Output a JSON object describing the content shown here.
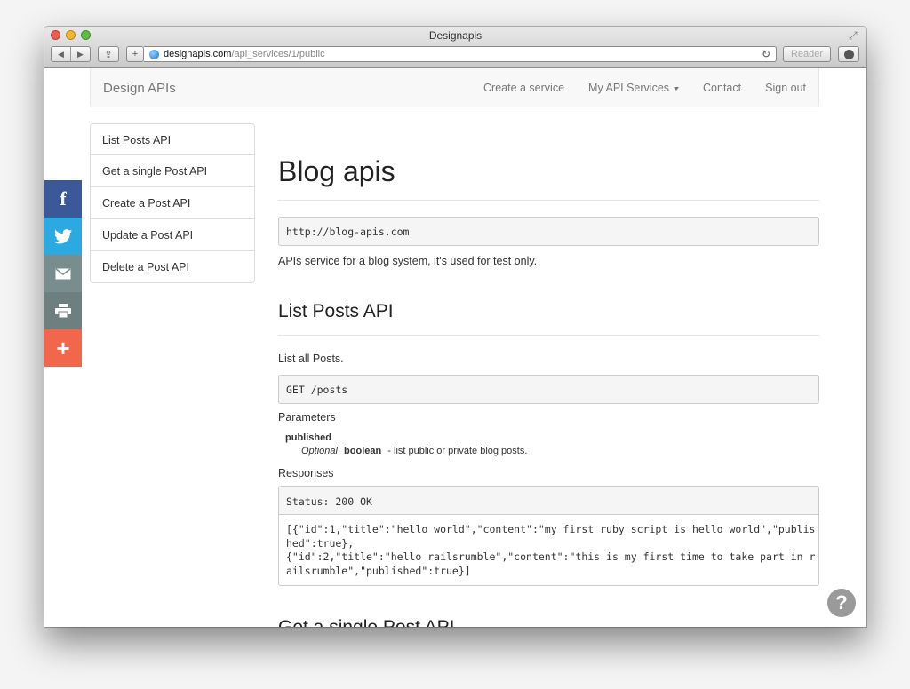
{
  "window": {
    "title": "Designapis",
    "url_domain": "designapis.com",
    "url_path": "/api_services/1/public",
    "reader_label": "Reader"
  },
  "navbar": {
    "brand": "Design APIs",
    "links": [
      "Create a service",
      "My API Services",
      "Contact",
      "Sign out"
    ]
  },
  "sidebar": {
    "items": [
      "List Posts API",
      "Get a single Post API",
      "Create a Post API",
      "Update a Post API",
      "Delete a Post API"
    ]
  },
  "share": {
    "icons": [
      "facebook-icon",
      "twitter-icon",
      "email-icon",
      "print-icon",
      "plus-icon"
    ],
    "colors": [
      "#3b5998",
      "#2ba9e1",
      "#7a8d8e",
      "#6e7f80",
      "#f2664b"
    ]
  },
  "main": {
    "title": "Blog apis",
    "base_url": "http://blog-apis.com",
    "description": "APIs service for a blog system, it's used for test only.",
    "section": {
      "title": "List Posts API",
      "description": "List all Posts.",
      "request": "GET /posts",
      "parameters_heading": "Parameters",
      "param": {
        "name": "published",
        "optional": "Optional",
        "type": "boolean",
        "desc": "- list public or private blog posts."
      },
      "responses_heading": "Responses",
      "status": "Status: 200 OK",
      "body": "[{\"id\":1,\"title\":\"hello world\",\"content\":\"my first ruby script is hello world\",\"publis\nhed\":true},\n{\"id\":2,\"title\":\"hello railsrumble\",\"content\":\"this is my first time to take part in r\nailsrumble\",\"published\":true}]"
    },
    "next_section_title": "Get a single Post API"
  },
  "help": {
    "label": "?"
  }
}
